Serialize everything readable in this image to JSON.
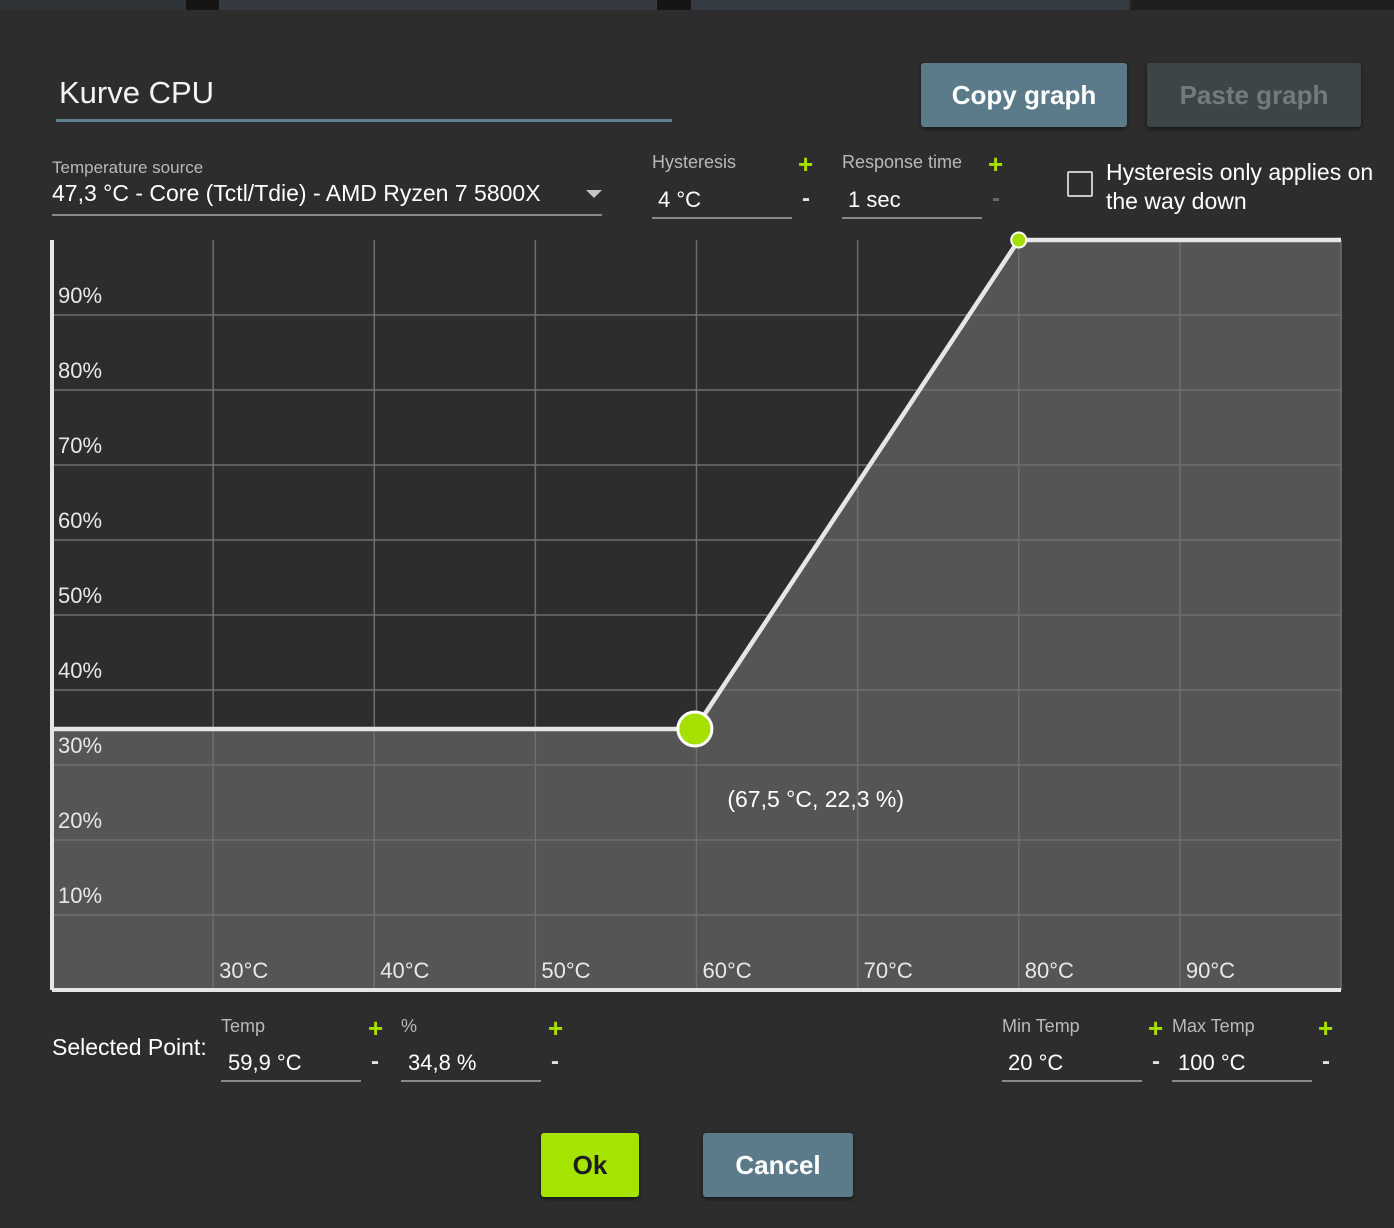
{
  "dialog": {
    "name": "Kurve CPU",
    "copy_label": "Copy graph",
    "paste_label": "Paste graph"
  },
  "temperature_source": {
    "label": "Temperature source",
    "value": "47,3 °C - Core (Tctl/Tdie) - AMD Ryzen 7 5800X"
  },
  "hysteresis": {
    "label": "Hysteresis",
    "value": "4 °C",
    "plus": "+",
    "minus": "-"
  },
  "response_time": {
    "label": "Response time",
    "value": "1 sec",
    "plus": "+",
    "minus": "-"
  },
  "hysteresis_down": {
    "label": "Hysteresis only applies on the way down",
    "checked": false
  },
  "selected_point": {
    "label": "Selected Point:",
    "temp_label": "Temp",
    "temp_value": "59,9 °C",
    "percent_label": "%",
    "percent_value": "34,8 %",
    "plus": "+",
    "minus": "-"
  },
  "min_temp": {
    "label": "Min Temp",
    "value": "20 °C",
    "plus": "+",
    "minus": "-"
  },
  "max_temp": {
    "label": "Max Temp",
    "value": "100 °C",
    "plus": "+",
    "minus": "-"
  },
  "footer": {
    "ok_label": "Ok",
    "cancel_label": "Cancel"
  },
  "colors": {
    "accent": "#a6e000",
    "button_blue": "#5c7b8a",
    "chart_dark": "#2d2d2d",
    "chart_fill": "#555555",
    "grid": "#6e6e6e",
    "curve": "#e6e6e6"
  },
  "chart_data": {
    "type": "line",
    "x_range": [
      20,
      100
    ],
    "y_range": [
      0,
      100
    ],
    "x_ticks": [
      30,
      40,
      50,
      60,
      70,
      80,
      90
    ],
    "y_ticks": [
      10,
      20,
      30,
      40,
      50,
      60,
      70,
      80,
      90
    ],
    "x_tick_labels": [
      "30°C",
      "40°C",
      "50°C",
      "60°C",
      "70°C",
      "80°C",
      "90°C"
    ],
    "y_tick_labels": [
      "10%",
      "20%",
      "30%",
      "40%",
      "50%",
      "60%",
      "70%",
      "80%",
      "90%"
    ],
    "grid": true,
    "series": [
      {
        "points": [
          {
            "x": 20,
            "y": 34.8
          },
          {
            "x": 59.9,
            "y": 34.8
          },
          {
            "x": 80,
            "y": 100
          },
          {
            "x": 100,
            "y": 100
          }
        ]
      }
    ],
    "control_points": [
      {
        "x": 59.9,
        "y": 34.8,
        "selected": true
      },
      {
        "x": 80,
        "y": 100,
        "selected": false
      }
    ],
    "hover_label": "(67,5 °C, 22,3 %)"
  }
}
